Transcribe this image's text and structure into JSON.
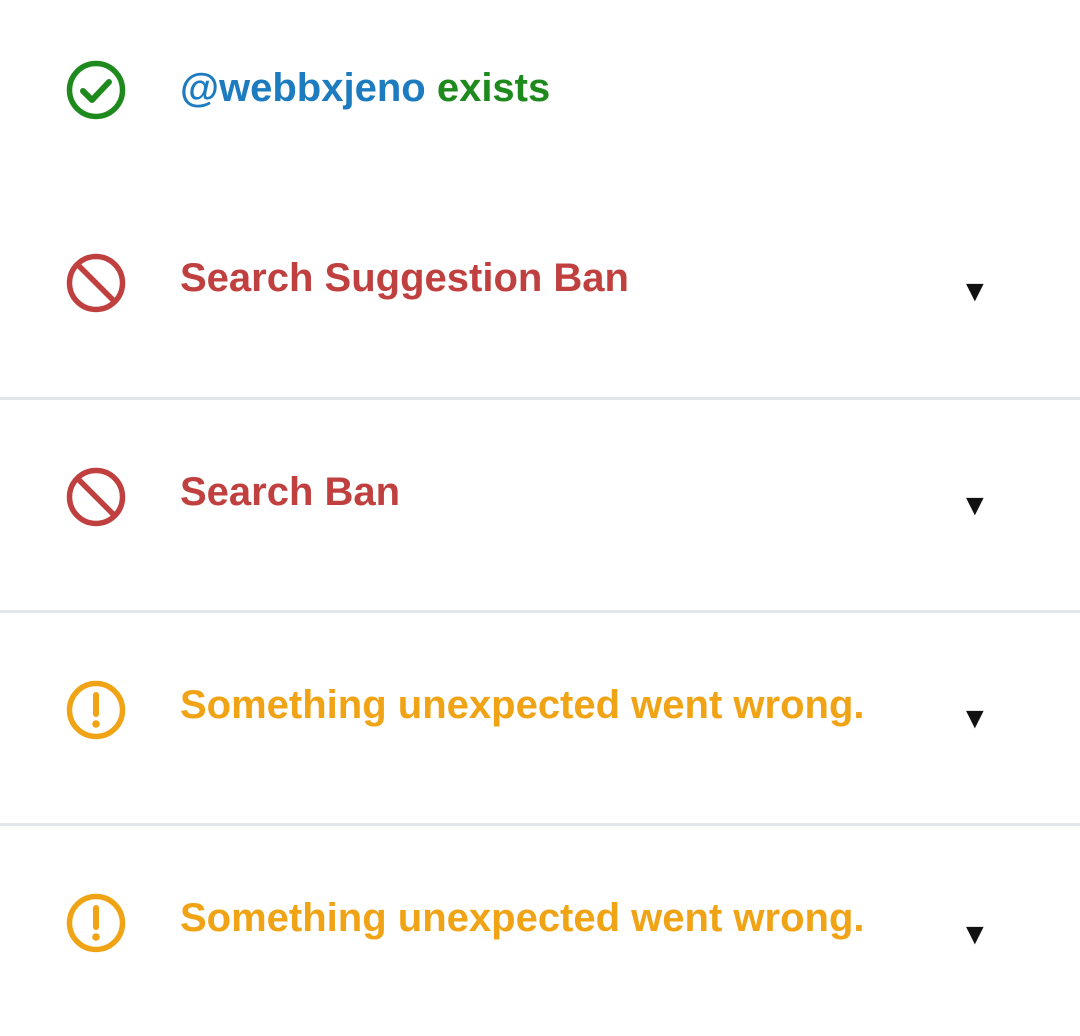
{
  "colors": {
    "success": "#1e8a1e",
    "handle": "#1d7cbf",
    "danger": "#c0403f",
    "warning": "#f0a314",
    "divider": "#e3e7ec",
    "chevron": "#111111"
  },
  "results": [
    {
      "status": "success",
      "icon": "check-circle-icon",
      "handle": "@webbxjeno",
      "text": "exists",
      "expandable": false
    },
    {
      "status": "danger",
      "icon": "ban-icon",
      "text": "Search Suggestion Ban",
      "expandable": true,
      "chevron": "▼"
    },
    {
      "status": "danger",
      "icon": "ban-icon",
      "text": "Search Ban",
      "expandable": true,
      "chevron": "▼"
    },
    {
      "status": "warning",
      "icon": "exclamation-circle-icon",
      "text": "Something unexpected went wrong.",
      "expandable": true,
      "chevron": "▼"
    },
    {
      "status": "warning",
      "icon": "exclamation-circle-icon",
      "text": "Something unexpected went wrong.",
      "expandable": true,
      "chevron": "▼"
    }
  ]
}
